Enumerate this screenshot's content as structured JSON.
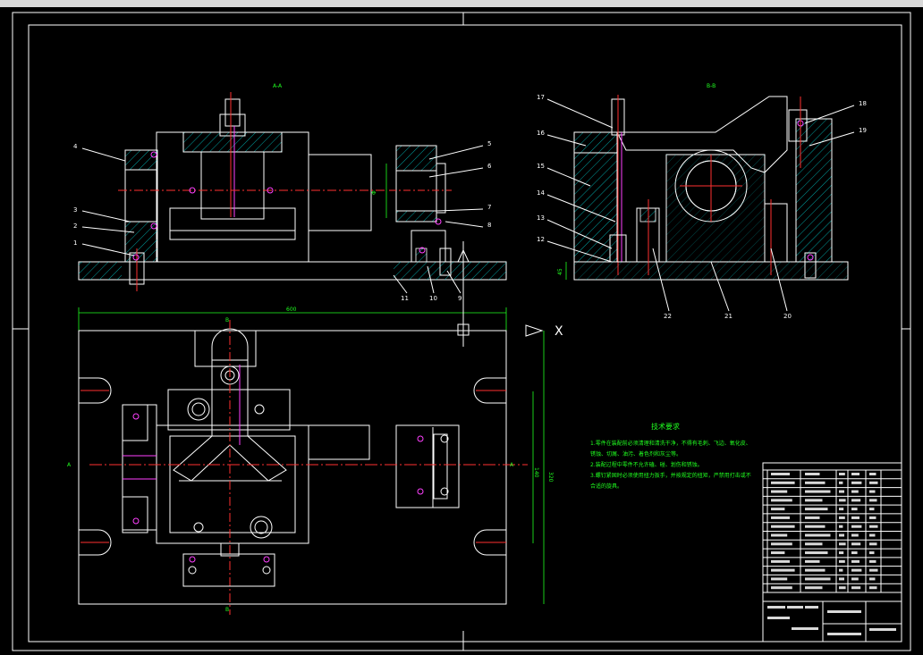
{
  "views": {
    "section_a": {
      "label": "A-A"
    },
    "section_b": {
      "label": "B-B"
    }
  },
  "dimensions": {
    "overall_length": "600",
    "overall_width": "320",
    "height_left": "140",
    "height_right": "45"
  },
  "section_marks": {
    "a_left": "A",
    "a_right": "A",
    "b_top": "B",
    "b_bottom": "B"
  },
  "part_numbers_a": [
    "4",
    "3",
    "2",
    "1",
    "5",
    "6",
    "7",
    "8",
    "11",
    "10",
    "9"
  ],
  "part_numbers_b": [
    "17",
    "16",
    "15",
    "14",
    "13",
    "12",
    "18",
    "19",
    "22",
    "21",
    "20"
  ],
  "technical_requirements": {
    "title": "技术要求",
    "lines": [
      "1.零件在装配前必须清理和清洗干净，不得有毛刺、飞边、氧化皮、",
      "锈蚀、切屑、油污、着色剂和灰尘等。",
      "2.装配过程中零件不允许磕、碰、划伤和锈蚀。",
      "3.螺钉紧固时必须使用扭力扳手，并按规定的扭矩，严禁用打击或不",
      "合适的旋具。"
    ]
  },
  "colors": {
    "background": "#000000",
    "outline": "#ffffff",
    "hatch": "#00e0e0",
    "center_line": "#ff3030",
    "dimension": "#20ff20",
    "hidden": "#f0f000",
    "bolt": "#ff40ff"
  }
}
